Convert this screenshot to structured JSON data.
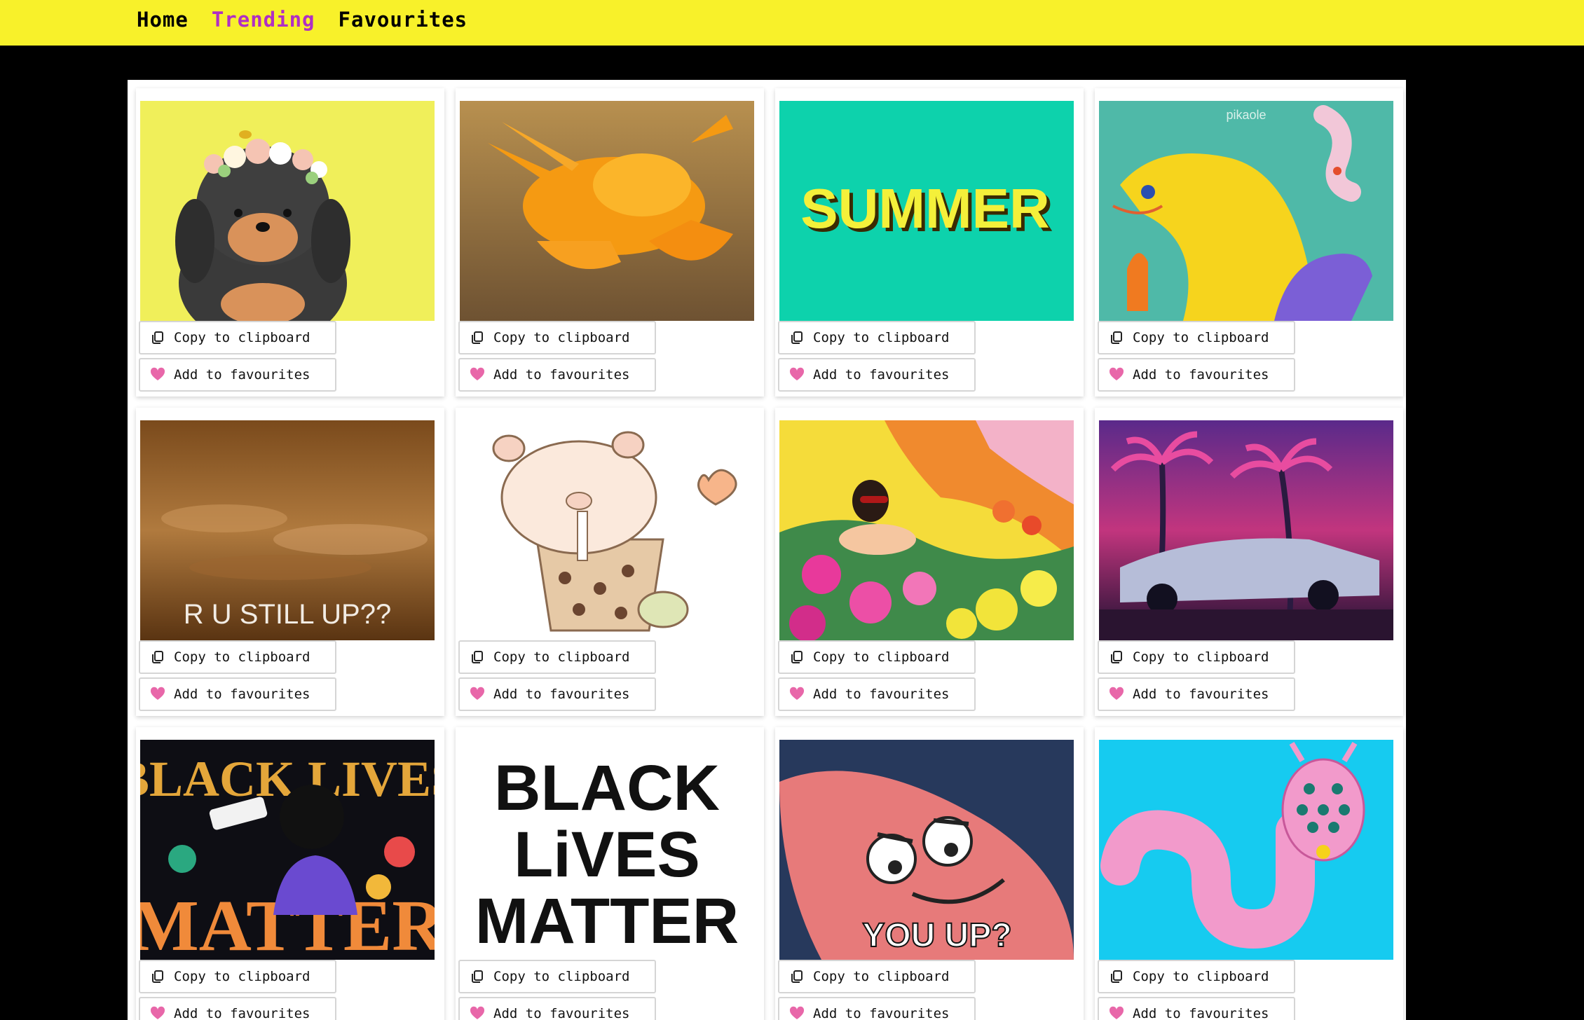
{
  "nav": {
    "items": [
      {
        "label": "Home",
        "active": false
      },
      {
        "label": "Trending",
        "active": true
      },
      {
        "label": "Favourites",
        "active": false
      }
    ],
    "bar_color": "#f8f12a",
    "active_color": "#b02fc4"
  },
  "buttons": {
    "copy_label": "Copy to clipboard",
    "fav_label": "Add to favourites",
    "copy_icon": "clipboard-icon",
    "fav_icon": "heart-icon",
    "heart_color": "#e867a9"
  },
  "gifs": [
    {
      "id": "puppy-flower-crown",
      "caption": ""
    },
    {
      "id": "orange-crab",
      "caption": ""
    },
    {
      "id": "summer",
      "caption": "SUMMER"
    },
    {
      "id": "yellow-eel",
      "caption": "pikaole"
    },
    {
      "id": "sand",
      "caption": "R U STILL UP??"
    },
    {
      "id": "bubble-tea-pig",
      "caption": ""
    },
    {
      "id": "flowers-sunbather",
      "caption": ""
    },
    {
      "id": "retro-car-palms",
      "caption": ""
    },
    {
      "id": "blm-colorful",
      "caption": "BLACK LIVES MATTER"
    },
    {
      "id": "blm-text",
      "caption": "BLACK LiVES MATTER"
    },
    {
      "id": "patrick",
      "caption": "YOU UP?"
    },
    {
      "id": "pink-worm",
      "caption": ""
    }
  ]
}
